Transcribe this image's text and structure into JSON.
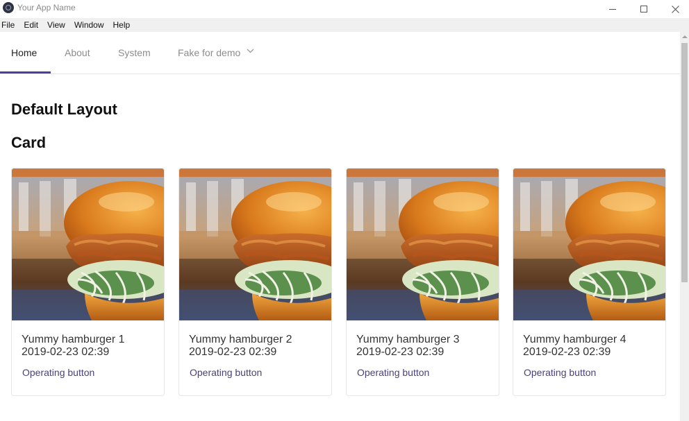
{
  "window": {
    "title": "Your App Name"
  },
  "menu": {
    "items": [
      "File",
      "Edit",
      "View",
      "Window",
      "Help"
    ]
  },
  "tabs": [
    {
      "label": "Home",
      "active": true
    },
    {
      "label": "About",
      "active": false
    },
    {
      "label": "System",
      "active": false
    },
    {
      "label": "Fake for demo",
      "active": false
    }
  ],
  "content": {
    "heading": "Default Layout",
    "subheading": "Card"
  },
  "cards": [
    {
      "title": "Yummy hamburger 1",
      "date": "2019-02-23 02:39",
      "button": "Operating button"
    },
    {
      "title": "Yummy hamburger 2",
      "date": "2019-02-23 02:39",
      "button": "Operating button"
    },
    {
      "title": "Yummy hamburger 3",
      "date": "2019-02-23 02:39",
      "button": "Operating button"
    },
    {
      "title": "Yummy hamburger 4",
      "date": "2019-02-23 02:39",
      "button": "Operating button"
    }
  ],
  "colors": {
    "accent": "#4a3f9c",
    "link": "#4a3f7a",
    "menubar": "#f0f0f0"
  }
}
